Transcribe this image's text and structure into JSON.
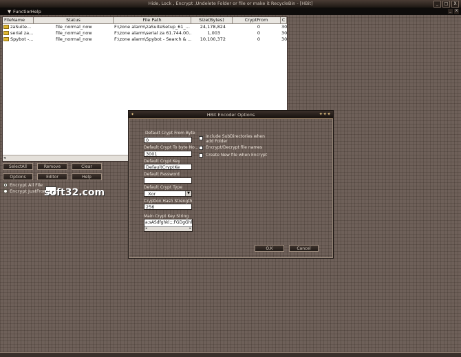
{
  "window": {
    "title": "Hide, Lock , Encrypt ,Undelete Folder or file or make it RecycleBin - [HBit]",
    "controls": [
      "_",
      "□",
      "X"
    ]
  },
  "menu": {
    "items": [
      "Function",
      "Help"
    ],
    "right_controls": [
      "_",
      "X"
    ]
  },
  "file_list": {
    "columns": [
      "FileName",
      "Status",
      "File Path",
      "Size(Bytes)",
      "CryptFrom",
      "C"
    ],
    "rows": [
      {
        "name": "zaSuite...",
        "status": "file_normal_now",
        "path": "F:\\zone alarm\\zaSuiteSetup_61_...",
        "size": "24,178,824",
        "crypt": "0",
        "c": "30"
      },
      {
        "name": "serial za...",
        "status": "file_normal_now",
        "path": "F:\\zone alarm\\serial za 61.744.00...",
        "size": "1,003",
        "crypt": "0",
        "c": "30"
      },
      {
        "name": "Spybot -...",
        "status": "file_normal_now",
        "path": "F:\\zone alarm\\Spybot - Search & ...",
        "size": "10,100,372",
        "crypt": "0",
        "c": "30"
      }
    ]
  },
  "buttons": {
    "selectall": "SelectAll",
    "remove": "Remove",
    "clear": "Clear",
    "options": "Options",
    "editor": "Editor",
    "help": "Help"
  },
  "radio": {
    "encrypt_all": "Encrypt All File",
    "encrypt_just": "Encrypt JustFrom"
  },
  "watermark": "soft32.com",
  "dialog": {
    "title": "HBit Encoder Options",
    "crypt_from_label": "Default Crypt From Byte",
    "crypt_from_value": "0",
    "crypt_to_label": "Default Crypt To byte No...",
    "crypt_to_value": "3001",
    "crypt_key_label": "Default Crypt Key",
    "crypt_key_value": "DefaultCryptKe",
    "password_label": "Default Password",
    "password_value": "",
    "crypt_type_label": "Default Crypt Type",
    "crypt_type_value": "_Xor",
    "hash_label": "Cryption Hash Strength",
    "hash_value": "256",
    "main_key_label": "Main Crypt Key String",
    "main_key_value": "a;sASdfghkl;;;FGDgGhhfjj",
    "checkbox_subdir": "Include SubDirectories when add Folder",
    "checkbox_names": "Encrypt/Decrypt file names",
    "checkbox_new": "Create New file when Encrypt",
    "ok": "O.K",
    "cancel": "Cancel"
  }
}
